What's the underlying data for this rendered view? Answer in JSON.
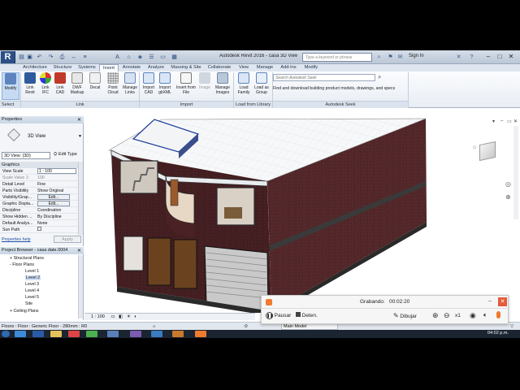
{
  "titlebar": {
    "app_logo": "R",
    "document_title": "Autodesk Revit 2016 - casa 3D View: {3D}",
    "search_placeholder": "Type a keyword or phrase",
    "sign_in": "Sign In"
  },
  "tabs": [
    "Architecture",
    "Structure",
    "Systems",
    "Insert",
    "Annotate",
    "Analyze",
    "Massing & Site",
    "Collaborate",
    "View",
    "Manage",
    "Add-Ins",
    "Modify"
  ],
  "active_tab": "Insert",
  "ribbon": {
    "modify": {
      "label": "Modify"
    },
    "link": {
      "label": "Link",
      "buttons": [
        "Link Revit",
        "Link IFC",
        "Link CAD",
        "DWF Markup",
        "Decal",
        "Point Cloud",
        "Manage Links"
      ]
    },
    "import": {
      "label": "Import",
      "buttons": [
        "Import CAD",
        "Import gbXML",
        "Insert from File",
        "Image",
        "Manage Images"
      ]
    },
    "load_from_library": {
      "label": "Load from Library",
      "buttons": [
        "Load Family",
        "Load as Group"
      ]
    },
    "seek": {
      "label": "Autodesk Seek",
      "search_placeholder": "Search Autodesk Seek",
      "description": "Find and download building product models, drawings, and specs"
    },
    "select_label": "Select"
  },
  "properties": {
    "title": "Properties",
    "type_name": "3D View",
    "view_selector": "3D View: {3D}",
    "edit_type": "Edit Type",
    "section": "Graphics",
    "rows": [
      {
        "key": "View Scale",
        "value": "1 : 100"
      },
      {
        "key": "Scale Value   1:",
        "value": "100"
      },
      {
        "key": "Detail Level",
        "value": "Fine"
      },
      {
        "key": "Parts Visibility",
        "value": "Show Original"
      },
      {
        "key": "Visibility/Grap...",
        "value": "Edit..."
      },
      {
        "key": "Graphic Displa...",
        "value": "Edit..."
      },
      {
        "key": "Discipline",
        "value": "Coordination"
      },
      {
        "key": "Show Hidden ...",
        "value": "By Discipline"
      },
      {
        "key": "Default Analys...",
        "value": "None"
      },
      {
        "key": "Sun Path",
        "value": ""
      }
    ],
    "help": "Properties help",
    "apply": "Apply"
  },
  "project_browser": {
    "title": "Project Browser - casa date.0004",
    "items": [
      {
        "label": "Structural Plans",
        "level": 1,
        "toggle": "+"
      },
      {
        "label": "Floor Plans",
        "level": 1,
        "toggle": "-"
      },
      {
        "label": "Level 1",
        "level": 2,
        "toggle": ""
      },
      {
        "label": "Level 2",
        "level": 2,
        "toggle": ""
      },
      {
        "label": "Level 3",
        "level": 2,
        "toggle": ""
      },
      {
        "label": "Level 4",
        "level": 2,
        "toggle": ""
      },
      {
        "label": "Level 5",
        "level": 2,
        "toggle": ""
      },
      {
        "label": "Site",
        "level": 2,
        "toggle": ""
      },
      {
        "label": "Ceiling Plans",
        "level": 1,
        "toggle": "+"
      }
    ]
  },
  "view_bar": {
    "scale": "1 : 100"
  },
  "status_bar": {
    "message": "Floors : Floor : Generic Floor - 280mm : R0",
    "coordinate": ":0",
    "model": "Main Model"
  },
  "recorder": {
    "status": "Grabando:",
    "time": "00:02:20",
    "pause": "Pausar",
    "stop": "Deten.",
    "draw": "Dibujar",
    "zoom": "x1"
  },
  "taskbar": {
    "clock": "04:02 p.m."
  },
  "colors": {
    "brick": "#5a2b2e",
    "ribbon_active": "#c6dbf3",
    "recorder_accent": "#f07a2e"
  }
}
